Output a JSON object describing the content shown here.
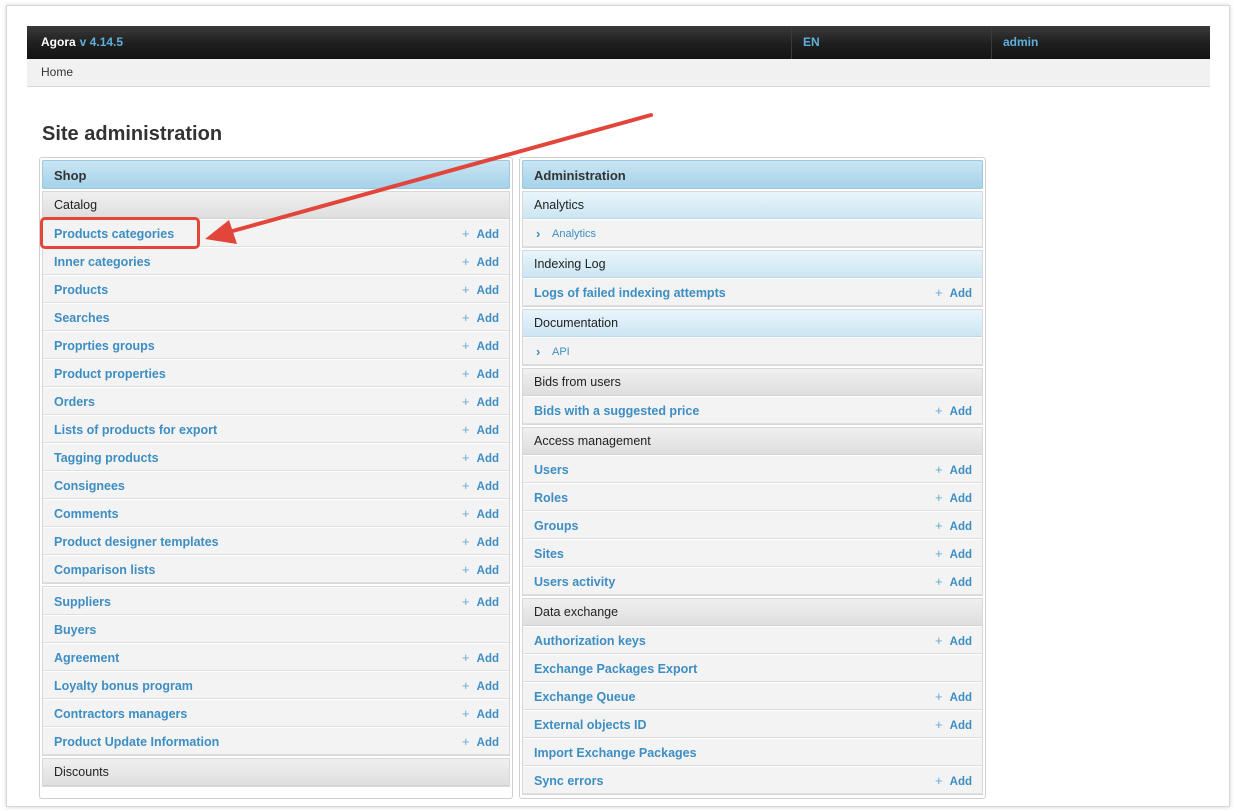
{
  "header": {
    "app_name": "Agora",
    "version": "v 4.14.5",
    "language": "EN",
    "user": "admin"
  },
  "breadcrumb": {
    "home": "Home"
  },
  "page_title": "Site administration",
  "shop": {
    "title": "Shop",
    "catalog_label": "Catalog",
    "add_label": "Add",
    "catalog_items": [
      "Products categories",
      "Inner categories",
      "Products",
      "Searches",
      "Proprties groups",
      "Product properties",
      "Orders",
      "Lists of products for export",
      "Tagging products",
      "Consignees",
      "Comments",
      "Product designer templates",
      "Comparison lists"
    ],
    "other_items": [
      "Suppliers",
      "Buyers",
      "Agreement",
      "Loyalty bonus program",
      "Contractors managers",
      "Product Update Information"
    ],
    "discounts_label": "Discounts"
  },
  "administration": {
    "title": "Administration",
    "add_label": "Add",
    "analytics": {
      "label": "Analytics",
      "link": "Analytics"
    },
    "indexing_log": {
      "label": "Indexing Log",
      "item": "Logs of failed indexing attempts"
    },
    "documentation": {
      "label": "Documentation",
      "link": "API"
    },
    "bids": {
      "label": "Bids from users",
      "item": "Bids with a suggested price"
    },
    "access": {
      "label": "Access management",
      "items": [
        "Users",
        "Roles",
        "Groups",
        "Sites",
        "Users activity"
      ]
    },
    "data_exchange": {
      "label": "Data exchange",
      "items": [
        "Authorization keys",
        "Exchange Packages Export",
        "Exchange Queue",
        "External objects ID",
        "Import Exchange Packages",
        "Sync errors"
      ]
    }
  },
  "annotation_color": "#e2453a",
  "link_color": "#3d8ec3"
}
